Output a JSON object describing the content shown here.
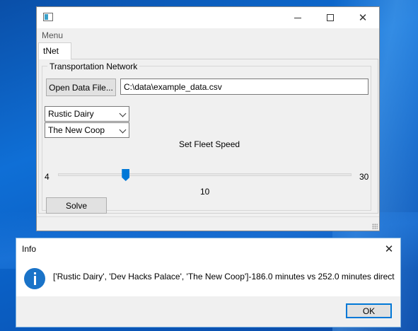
{
  "main_window": {
    "title": "",
    "menu": [
      "Menu"
    ],
    "tabs": [
      {
        "label": "tNet",
        "active": true
      }
    ],
    "group": {
      "title": "Transportation Network",
      "open_button_label": "Open Data File...",
      "file_path": "C:\\data\\example_data.csv",
      "origin_select": {
        "selected": "Rustic Dairy"
      },
      "destination_select": {
        "selected": "The New Coop"
      },
      "fleet_speed": {
        "label": "Set Fleet Speed",
        "min_label": "4",
        "max_label": "30",
        "min": 4,
        "max": 30,
        "value": 10,
        "value_label": "10"
      },
      "solve_button_label": "Solve"
    }
  },
  "dialog": {
    "title": "Info",
    "icon": "info-icon",
    "message": "['Rustic Dairy', 'Dev Hacks Palace', 'The New Coop']-186.0 minutes vs 252.0 minutes direct",
    "ok_label": "OK"
  },
  "colors": {
    "accent": "#0078d7",
    "info_icon": "#1a73c8",
    "window_bg": "#f0f0f0",
    "desktop": "#0f6fd6"
  }
}
